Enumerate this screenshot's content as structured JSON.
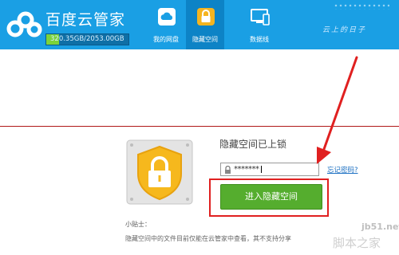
{
  "app": {
    "title": "百度云管家",
    "capacity_text": "320.35GB/2053.00GB",
    "capacity_fraction": 0.156,
    "slogan": "云上的日子"
  },
  "tabs": [
    {
      "label": "我的网盘",
      "icon": "cloud-drive-icon",
      "active": false
    },
    {
      "label": "隐藏空间",
      "icon": "vault-lock-icon",
      "active": true
    },
    {
      "label": "数据线",
      "icon": "devices-icon",
      "active": false
    }
  ],
  "vault": {
    "status_title": "隐藏空间已上锁",
    "password_value": "*******",
    "forgot_link": "忘记密码?",
    "enter_button": "进入隐藏空间"
  },
  "tip": {
    "title": "小贴士：",
    "text": "隐藏空间中的文件目前仅能在云管家中查看，其不支持分享"
  },
  "watermark": {
    "url": "jb51.net",
    "site_name": "脚本之家"
  },
  "colors": {
    "header": "#1a9fe4",
    "active_tab": "#0d83c6",
    "enter_button": "#55ad2e",
    "annotation_red": "#e02020"
  }
}
